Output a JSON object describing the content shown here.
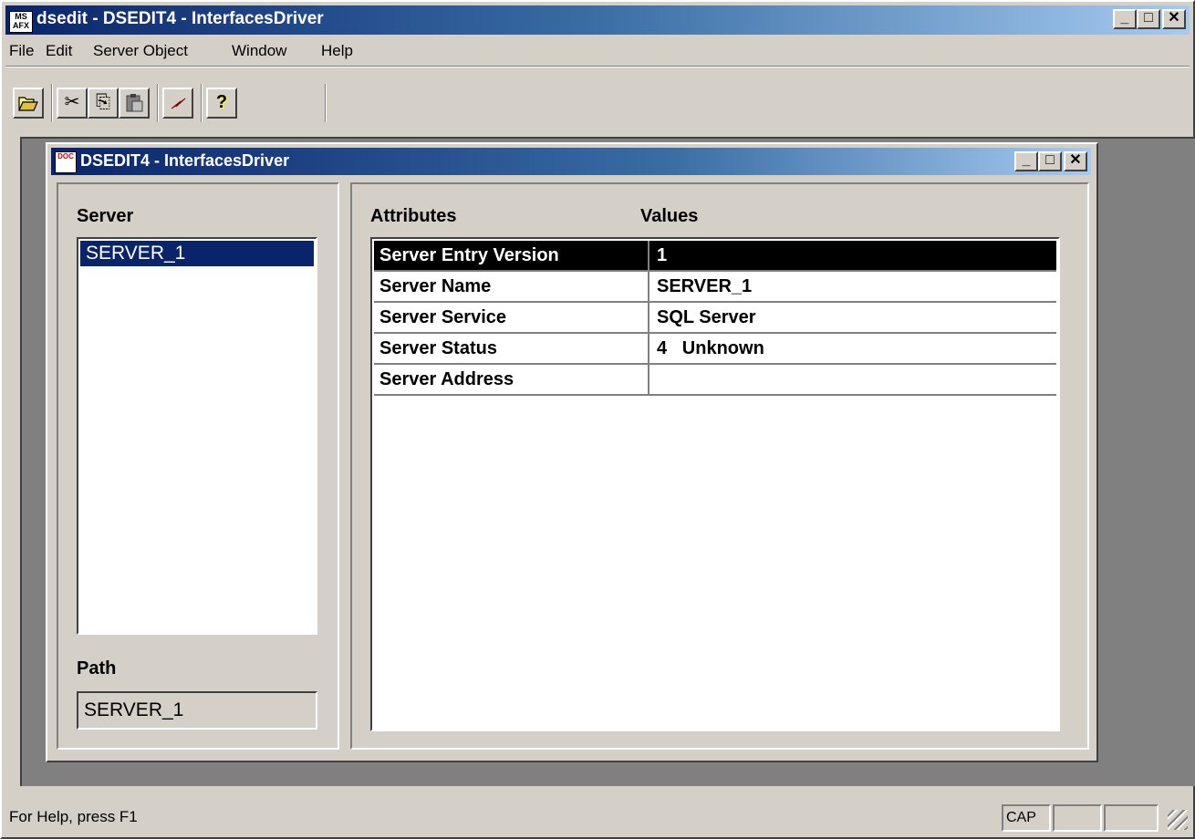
{
  "window": {
    "title": "dsedit - DSEDIT4 - InterfacesDriver",
    "app_icon_text": "MS AFX",
    "min_glyph": "_",
    "max_glyph": "□",
    "close_glyph": "✕"
  },
  "menu": {
    "items": [
      "File",
      "Edit",
      "Server Object",
      "Window",
      "Help"
    ]
  },
  "toolbar": {
    "open_icon": "open-folder-icon",
    "cut_glyph": "✂",
    "copy_glyph": "⎘",
    "paste_glyph": "📋",
    "ping_glyph": "⚡",
    "help_glyph": "?"
  },
  "child": {
    "title": "DSEDIT4 - InterfacesDriver",
    "icon_text": "DOC",
    "server_label": "Server",
    "servers": [
      "SERVER_1"
    ],
    "path_label": "Path",
    "path_value": "SERVER_1",
    "attributes_header": "Attributes",
    "values_header": "Values",
    "rows": [
      {
        "attribute": "Server Entry Version",
        "value": "1"
      },
      {
        "attribute": "Server Name",
        "value": "SERVER_1"
      },
      {
        "attribute": "Server Service",
        "value": "SQL Server"
      },
      {
        "attribute": "Server Status",
        "value": "4   Unknown"
      },
      {
        "attribute": "Server Address",
        "value": ""
      }
    ]
  },
  "status": {
    "text": "For Help, press F1",
    "cap": "CAP",
    "num": "",
    "scrl": ""
  },
  "colors": {
    "title_active": "#0a246a",
    "face": "#d4d0c8",
    "selection": "#0a246a",
    "grid_selection": "#000000"
  }
}
